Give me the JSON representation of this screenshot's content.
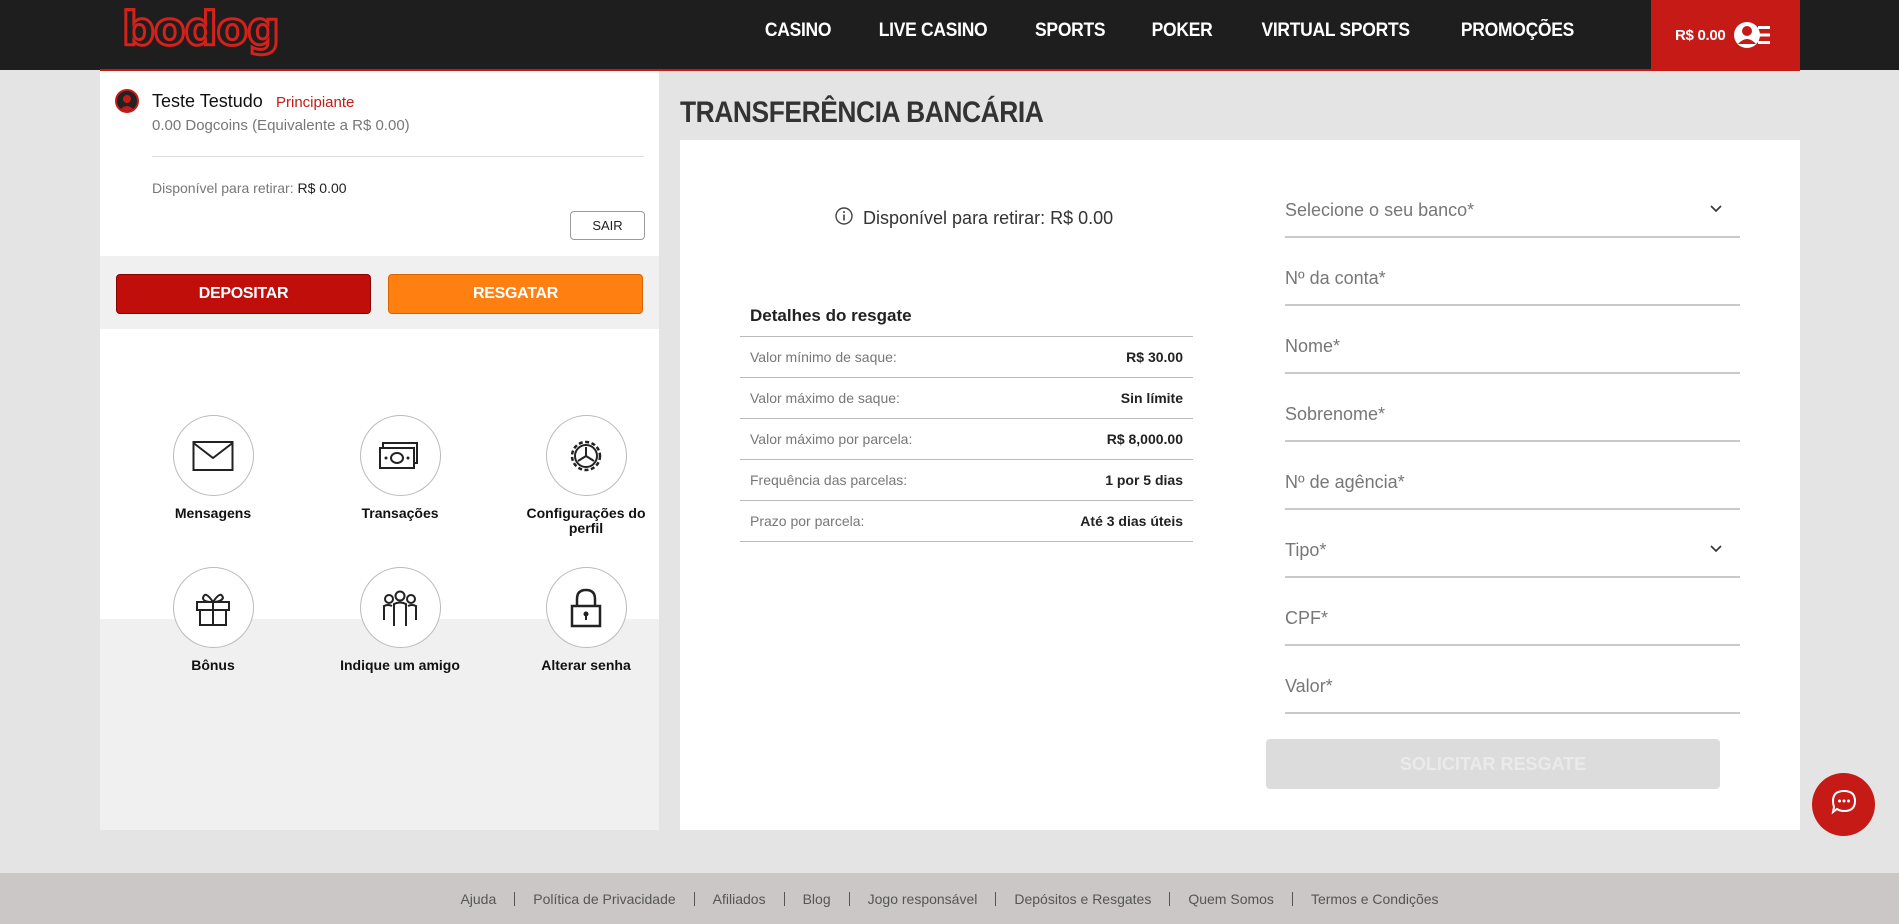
{
  "header": {
    "logo": "bodog",
    "nav": [
      "CASINO",
      "LIVE CASINO",
      "SPORTS",
      "POKER",
      "VIRTUAL SPORTS",
      "PROMOÇÕES"
    ],
    "balance": "R$ 0.00",
    "accent_color": "#c61a16"
  },
  "sidebar": {
    "username": "Teste Testudo",
    "level": "Principiante",
    "dogcoins": "0.00 Dogcoins (Equivalente a R$ 0.00)",
    "available_label": "Disponível para retirar:",
    "available_value": "R$ 0.00",
    "logout_label": "SAIR",
    "deposit_label": "DEPOSITAR",
    "withdraw_label": "RESGATAR",
    "tiles": [
      {
        "label": "Mensagens",
        "icon": "envelope-icon"
      },
      {
        "label": "Transações",
        "icon": "money-icon"
      },
      {
        "label": "Configurações do perfil",
        "icon": "gear-icon"
      },
      {
        "label": "Bônus",
        "icon": "gift-icon"
      },
      {
        "label": "Indique um amigo",
        "icon": "people-icon"
      },
      {
        "label": "Alterar senha",
        "icon": "lock-icon"
      }
    ]
  },
  "main": {
    "title": "TRANSFERÊNCIA BANCÁRIA",
    "available_text": "Disponível para retirar: R$ 0.00",
    "details_title": "Detalhes do resgate",
    "details": [
      {
        "label": "Valor mínimo de saque:",
        "value": "R$ 30.00"
      },
      {
        "label": "Valor máximo de saque:",
        "value": "Sin límite"
      },
      {
        "label": "Valor máximo por parcela:",
        "value": "R$ 8,000.00"
      },
      {
        "label": "Frequência das parcelas:",
        "value": "1 por 5 dias"
      },
      {
        "label": "Prazo por parcela:",
        "value": "Até 3 dias úteis"
      }
    ],
    "form": {
      "bank_placeholder": "Selecione o seu banco*",
      "account_placeholder": "Nº da conta*",
      "name_placeholder": "Nome*",
      "surname_placeholder": "Sobrenome*",
      "agency_placeholder": "Nº de agência*",
      "type_placeholder": "Tipo*",
      "cpf_placeholder": "CPF*",
      "amount_placeholder": "Valor*",
      "submit_label": "SOLICITAR RESGATE"
    }
  },
  "footer": {
    "links": [
      "Ajuda",
      "Política de Privacidade",
      "Afiliados",
      "Blog",
      "Jogo responsável",
      "Depósitos e Resgates",
      "Quem Somos",
      "Termos e Condições"
    ]
  }
}
